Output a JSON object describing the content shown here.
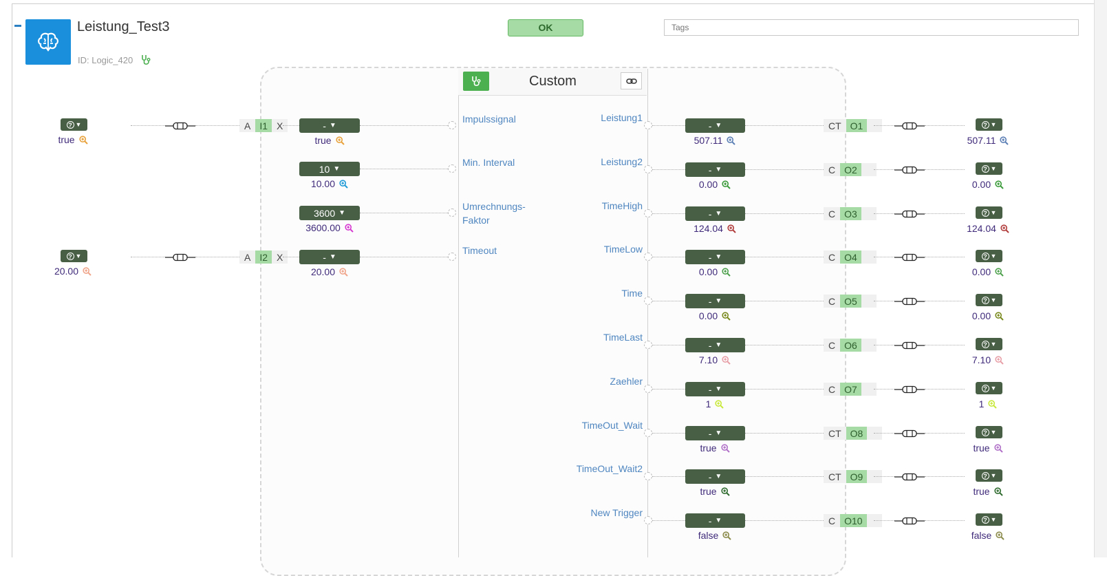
{
  "block": {
    "title": "Leistung_Test3",
    "id_label": "ID: Logic_420",
    "status": "OK",
    "tags_placeholder": "Tags",
    "core_title": "Custom"
  },
  "icons": {
    "brain": "brain-icon",
    "stethoscope": "stethoscope-icon",
    "link": "link-icon",
    "connector": "connector-plug-icon",
    "magnifier": "zoom-in-icon",
    "help": "question-circle-icon",
    "chevron": "chevron-down-icon",
    "collapse": "minus-collapse-icon"
  },
  "colors": {
    "accent_blue": "#1a8fdc",
    "dropdown_bg": "#485f45",
    "ok_bg": "#a7dba5",
    "pin_label": "#4f86c0",
    "value_text": "#3f2a7a"
  },
  "inputs": [
    {
      "label": "Impulssignal",
      "dd": "-",
      "value": "true",
      "mag": "#e8a13a",
      "src": {
        "value": "true",
        "mag": "#e8a13a",
        "chip": {
          "left": "A",
          "name": "I1",
          "right": "X"
        }
      }
    },
    {
      "label": "Min. Interval",
      "dd": "10",
      "value": "10.00",
      "mag": "#1e9ad6"
    },
    {
      "label": "Umrechnungs-Faktor",
      "label_lines": [
        "Umrechnungs-",
        "Faktor"
      ],
      "dd": "3600",
      "value": "3600.00",
      "mag": "#d63ad0"
    },
    {
      "label": "Timeout",
      "dd": "-",
      "value": "20.00",
      "mag": "#f0a58a",
      "src": {
        "value": "20.00",
        "mag": "#f0a58a",
        "chip": {
          "left": "A",
          "name": "I2",
          "right": "X"
        }
      }
    }
  ],
  "outputs": [
    {
      "label": "Leistung1",
      "dd": "-",
      "value": "507.11",
      "mag": "#5b7fb5",
      "chip": "CT",
      "name": "O1",
      "ext": "507.11"
    },
    {
      "label": "Leistung2",
      "dd": "-",
      "value": "0.00",
      "mag": "#3a9a3a",
      "chip": "C",
      "name": "O2",
      "ext": "0.00"
    },
    {
      "label": "TimeHigh",
      "dd": "-",
      "value": "124.04",
      "mag": "#b03a3a",
      "chip": "C",
      "name": "O3",
      "ext": "124.04"
    },
    {
      "label": "TimeLow",
      "dd": "-",
      "value": "0.00",
      "mag": "#4ca04c",
      "chip": "C",
      "name": "O4",
      "ext": "0.00"
    },
    {
      "label": "Time",
      "dd": "-",
      "value": "0.00",
      "mag": "#7a8a1e",
      "chip": "C",
      "name": "O5",
      "ext": "0.00"
    },
    {
      "label": "TimeLast",
      "dd": "-",
      "value": "7.10",
      "mag": "#e8a0a8",
      "chip": "C",
      "name": "O6",
      "ext": "7.10"
    },
    {
      "label": "Zaehler",
      "dd": "-",
      "value": "1",
      "mag": "#c8e83a",
      "chip": "C",
      "name": "O7",
      "ext": "1"
    },
    {
      "label": "TimeOut_Wait",
      "dd": "-",
      "value": "true",
      "mag": "#b070c8",
      "chip": "CT",
      "name": "O8",
      "ext": "true"
    },
    {
      "label": "TimeOut_Wait2",
      "dd": "-",
      "value": "true",
      "mag": "#2d6a2d",
      "chip": "CT",
      "name": "O9",
      "ext": "true"
    },
    {
      "label": "New Trigger",
      "dd": "-",
      "value": "false",
      "mag": "#8a8a4a",
      "chip": "C",
      "name": "O10",
      "ext": "false"
    }
  ]
}
